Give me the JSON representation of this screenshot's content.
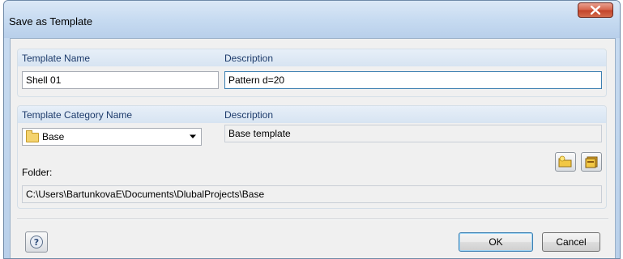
{
  "window": {
    "title": "Save as Template"
  },
  "template": {
    "name_header": "Template Name",
    "description_header": "Description",
    "name_value": "Shell 01",
    "description_value": "Pattern d=20"
  },
  "category": {
    "name_header": "Template Category Name",
    "description_header": "Description",
    "selected": "Base",
    "description_value": "Base template",
    "folder_label": "Folder:",
    "folder_path": "C:\\Users\\BartunkovaE\\Documents\\DlubalProjects\\Base"
  },
  "buttons": {
    "ok": "OK",
    "cancel": "Cancel"
  },
  "icons": {
    "close": "close-icon",
    "help": "help-icon",
    "new_category": "new-folder-icon",
    "delete_category": "delete-folder-icon",
    "combo_folder": "folder-icon",
    "combo_arrow": "chevron-down-icon"
  },
  "colors": {
    "header_text": "#1d3b6b",
    "close_button": "#c2432a",
    "focus_border": "#3c7fb1"
  }
}
